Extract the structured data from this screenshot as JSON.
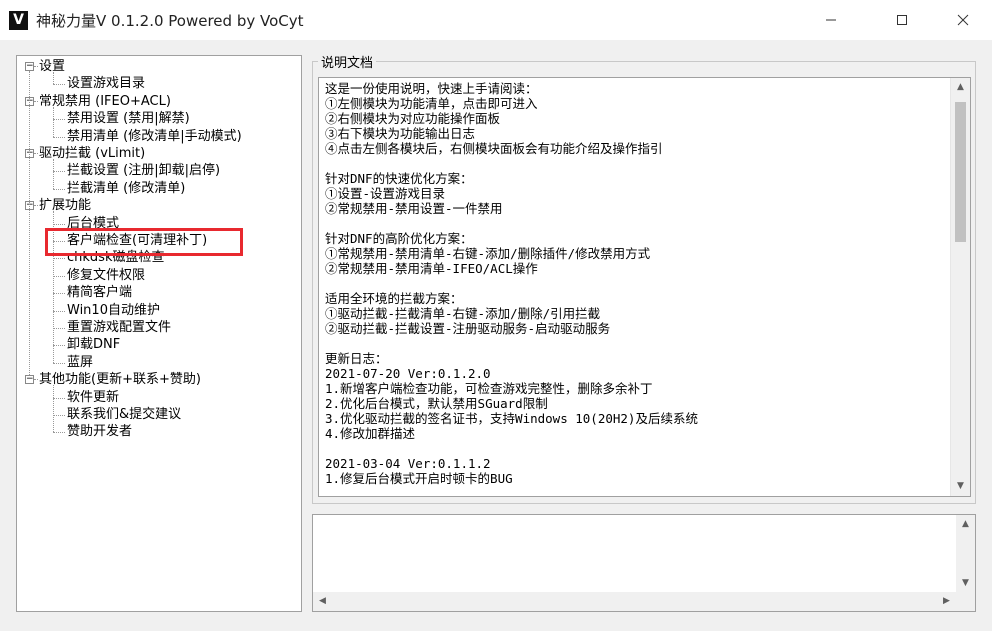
{
  "window": {
    "logo": "V",
    "title": "神秘力量V 0.1.2.0  Powered by VoCyt",
    "minimize_icon": "minimize-icon",
    "maximize_icon": "maximize-icon",
    "close_icon": "close-icon"
  },
  "tree": {
    "items": [
      {
        "label": "设置",
        "level": 0,
        "toggle": "−"
      },
      {
        "label": "设置游戏目录",
        "level": 1
      },
      {
        "label": "常规禁用 (IFEO+ACL)",
        "level": 0,
        "toggle": "−"
      },
      {
        "label": "禁用设置 (禁用|解禁)",
        "level": 1
      },
      {
        "label": "禁用清单 (修改清单|手动模式)",
        "level": 1
      },
      {
        "label": "驱动拦截 (vLimit)",
        "level": 0,
        "toggle": "−"
      },
      {
        "label": "拦截设置 (注册|卸载|启停)",
        "level": 1
      },
      {
        "label": "拦截清单 (修改清单)",
        "level": 1
      },
      {
        "label": "扩展功能",
        "level": 0,
        "toggle": "−"
      },
      {
        "label": "后台模式",
        "level": 1
      },
      {
        "label": "客户端检查(可清理补丁)",
        "level": 1
      },
      {
        "label": "chkdsk磁盘检查",
        "level": 1
      },
      {
        "label": "修复文件权限",
        "level": 1
      },
      {
        "label": "精简客户端",
        "level": 1
      },
      {
        "label": "Win10自动维护",
        "level": 1
      },
      {
        "label": "重置游戏配置文件",
        "level": 1
      },
      {
        "label": "卸载DNF",
        "level": 1
      },
      {
        "label": "蓝屏",
        "level": 1
      },
      {
        "label": "其他功能(更新+联系+赞助)",
        "level": 0,
        "toggle": "−"
      },
      {
        "label": "软件更新",
        "level": 1
      },
      {
        "label": "联系我们&提交建议",
        "level": 1
      },
      {
        "label": "赞助开发者",
        "level": 1
      }
    ]
  },
  "doc": {
    "legend": "说明文档",
    "text": "这是一份使用说明，快速上手请阅读：\n①左侧模块为功能清单，点击即可进入\n②右侧模块为对应功能操作面板\n③右下模块为功能输出日志\n④点击左侧各模块后，右侧模块面板会有功能介绍及操作指引\n\n针对DNF的快速优化方案：\n①设置-设置游戏目录\n②常规禁用-禁用设置-一件禁用\n\n针对DNF的高阶优化方案：\n①常规禁用-禁用清单-右键-添加/删除插件/修改禁用方式\n②常规禁用-禁用清单-IFEO/ACL操作\n\n适用全环境的拦截方案：\n①驱动拦截-拦截清单-右键-添加/删除/引用拦截\n②驱动拦截-拦截设置-注册驱动服务-启动驱动服务\n\n更新日志：\n2021-07-20 Ver:0.1.2.0\n1.新增客户端检查功能，可检查游戏完整性，删除多余补丁\n2.优化后台模式，默认禁用SGuard限制\n3.优化驱动拦截的签名证书，支持Windows 10(20H2)及后续系统\n4.修改加群描述\n\n2021-03-04 Ver:0.1.1.2\n1.修复后台模式开启时顿卡的BUG"
  },
  "log": {
    "text": ""
  }
}
